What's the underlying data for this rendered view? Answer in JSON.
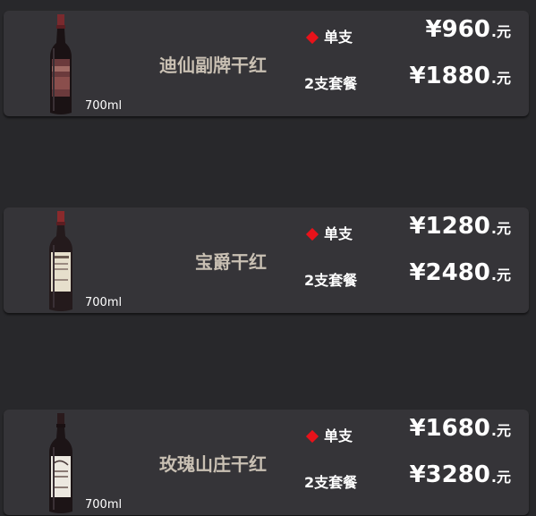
{
  "products": [
    {
      "name": "迪仙副牌干红",
      "volume": "700ml",
      "single_label": "单支",
      "single_price": "960",
      "double_label": "2支套餐",
      "double_price": "1880",
      "currency": "¥",
      "unit": ".元",
      "bottle_icon": "wine-bottle-dark-label"
    },
    {
      "name": "宝爵干红",
      "volume": "700ml",
      "single_label": "单支",
      "single_price": "1280",
      "double_label": "2支套餐",
      "double_price": "2480",
      "currency": "¥",
      "unit": ".元",
      "bottle_icon": "wine-bottle-cream-label"
    },
    {
      "name": "玫瑰山庄干红",
      "volume": "700ml",
      "single_label": "单支",
      "single_price": "1680",
      "double_label": "2支套餐",
      "double_price": "3280",
      "currency": "¥",
      "unit": ".元",
      "bottle_icon": "wine-bottle-white-label"
    }
  ],
  "colors": {
    "background": "#28282b",
    "card": "#353438",
    "name_text": "#c9c0b3",
    "diamond": "#e8121a",
    "price_text": "#ffffff"
  }
}
